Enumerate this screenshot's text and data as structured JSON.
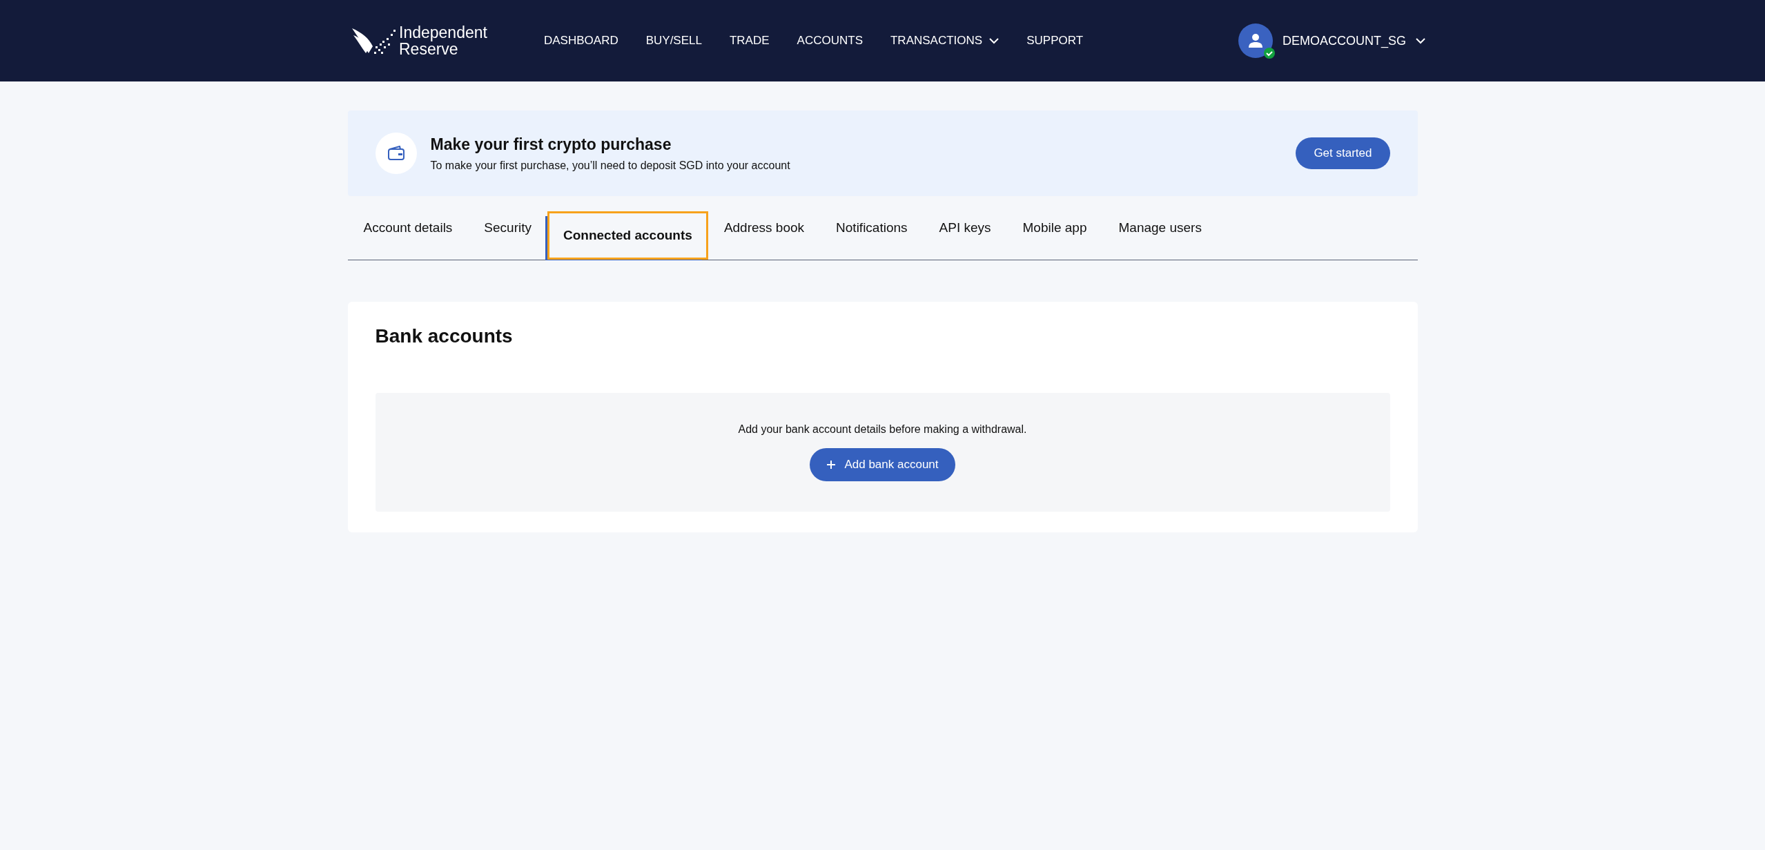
{
  "header": {
    "logo": {
      "lines": [
        "Independent",
        "Reserve"
      ]
    },
    "nav": [
      {
        "label": "DASHBOARD",
        "dropdown": false
      },
      {
        "label": "BUY/SELL",
        "dropdown": false
      },
      {
        "label": "TRADE",
        "dropdown": false
      },
      {
        "label": "ACCOUNTS",
        "dropdown": false
      },
      {
        "label": "TRANSACTIONS",
        "dropdown": true
      },
      {
        "label": "SUPPORT",
        "dropdown": false
      }
    ],
    "user": {
      "name": "DEMOACCOUNT_SG",
      "verified": true
    }
  },
  "banner": {
    "title": "Make your first crypto purchase",
    "subtitle": "To make your first purchase, you’ll need to deposit SGD into your account",
    "button": "Get started"
  },
  "tabs": [
    {
      "label": "Account details",
      "selected": false
    },
    {
      "label": "Security",
      "selected": false
    },
    {
      "label": "Connected accounts",
      "selected": true
    },
    {
      "label": "Address book",
      "selected": false
    },
    {
      "label": "Notifications",
      "selected": false
    },
    {
      "label": "API keys",
      "selected": false
    },
    {
      "label": "Mobile app",
      "selected": false
    },
    {
      "label": "Manage users",
      "selected": false
    }
  ],
  "bank_accounts": {
    "title": "Bank accounts",
    "message": "Add your bank account details before making a withdrawal.",
    "button": "Add bank account"
  }
}
